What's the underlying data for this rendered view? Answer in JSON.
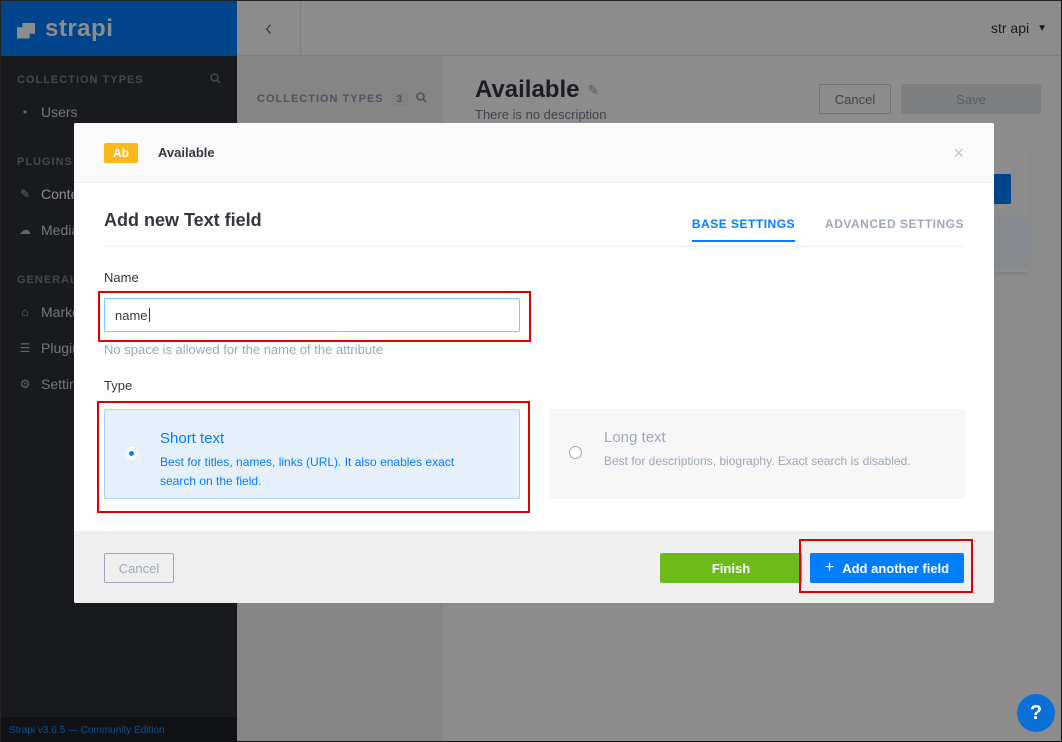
{
  "app": {
    "logo": "strapi",
    "footer": "Strapi v3.6.5 — Community Edition"
  },
  "sidebar": {
    "collection_types_label": "COLLECTION TYPES",
    "collection_items": [
      {
        "label": "Users",
        "icon": "bullet-icon"
      }
    ],
    "plugins_label": "PLUGINS",
    "plugin_items": [
      {
        "label": "Conte",
        "icon": "brush-icon"
      },
      {
        "label": "Media",
        "icon": "cloud-upload-icon"
      }
    ],
    "general_label": "GENERAL",
    "general_items": [
      {
        "label": "Marke",
        "icon": "basket-icon"
      },
      {
        "label": "Plugin",
        "icon": "list-icon"
      },
      {
        "label": "Settin",
        "icon": "gear-icon"
      }
    ]
  },
  "header": {
    "back": "‹",
    "user": "str api"
  },
  "middle": {
    "title": "COLLECTION TYPES",
    "count": "3"
  },
  "page": {
    "title": "Available",
    "description": "There is no description",
    "cancel": "Cancel",
    "save": "Save"
  },
  "modal": {
    "badge": "Ab",
    "header_title": "Available",
    "close": "×",
    "section_title": "Add new Text field",
    "tabs": [
      "BASE SETTINGS",
      "ADVANCED SETTINGS"
    ],
    "name_label": "Name",
    "name_value": "name",
    "name_hint": "No space is allowed for the name of the attribute",
    "type_label": "Type",
    "options": [
      {
        "title": "Short text",
        "desc": "Best for titles, names, links (URL). It also enables exact search on the field.",
        "selected": true
      },
      {
        "title": "Long text",
        "desc": "Best for descriptions, biography. Exact search is disabled.",
        "selected": false
      }
    ],
    "cancel": "Cancel",
    "finish": "Finish",
    "add_another": "Add another field"
  },
  "help": "?",
  "colors": {
    "primary": "#007eff",
    "success": "#6dbb1a",
    "badge": "#fab81b",
    "highlight": "#e00000"
  }
}
